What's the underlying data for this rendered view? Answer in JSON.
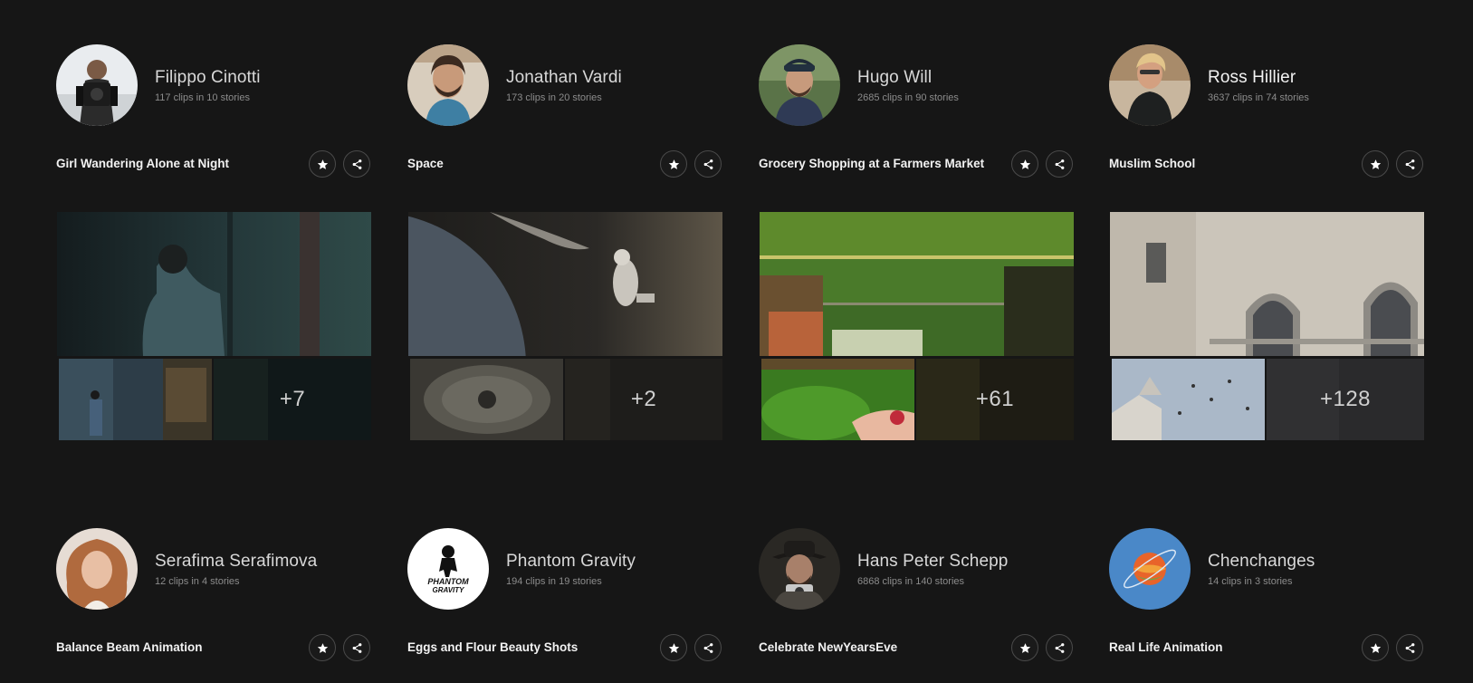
{
  "cards": [
    {
      "creator_name": "Filippo Cinotti",
      "creator_meta": "117 clips in 10 stories",
      "story_title": "Girl Wandering Alone at Night",
      "more_count": "+7",
      "colors": {
        "main": "#2a3d3c",
        "sub": "#24313a",
        "more": "#0f1a1a"
      }
    },
    {
      "creator_name": "Jonathan Vardi",
      "creator_meta": "173 clips in 20 stories",
      "story_title": "Space",
      "more_count": "+2",
      "colors": {
        "main": "#2c2a27",
        "sub": "#4a4740",
        "more": "#1c1b19"
      }
    },
    {
      "creator_name": "Hugo Will",
      "creator_meta": "2685 clips in 90 stories",
      "story_title": "Grocery Shopping at a Farmers Market",
      "more_count": "+61",
      "colors": {
        "main": "#4e7a2a",
        "sub": "#3d7422",
        "more": "#1c1a14"
      }
    },
    {
      "creator_name": "Ross Hillier",
      "creator_meta": "3637 clips in 74 stories",
      "story_title": "Muslim School",
      "more_count": "+128",
      "colors": {
        "main": "#c9c2b6",
        "sub": "#b9c3d0",
        "more": "#2a2a2c"
      }
    },
    {
      "creator_name": "Serafima Serafimova",
      "creator_meta": "12 clips in 4 stories",
      "story_title": "Balance Beam Animation"
    },
    {
      "creator_name": "Phantom Gravity",
      "creator_meta": "194 clips in 19 stories",
      "story_title": "Eggs and Flour Beauty Shots",
      "avatar_logo_text": "PHANTOM GRAVITY"
    },
    {
      "creator_name": "Hans Peter Schepp",
      "creator_meta": "6868 clips in 140 stories",
      "story_title": "Celebrate NewYearsEve"
    },
    {
      "creator_name": "Chenchanges",
      "creator_meta": "14 clips in 3 stories",
      "story_title": "Real Life Animation"
    }
  ],
  "icons": {
    "favorite": "star-icon",
    "share": "share-icon"
  },
  "theme": {
    "background": "#161616",
    "button_border": "#4a4a4a"
  }
}
